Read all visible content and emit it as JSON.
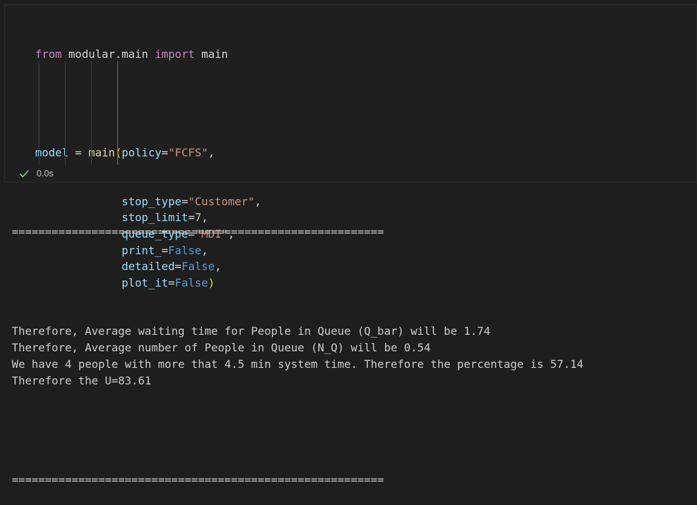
{
  "cell": {
    "import_line": {
      "from": "from",
      "module": "modular.main",
      "import": "import",
      "name": "main"
    },
    "call": {
      "var": "model",
      "eq": " = ",
      "fn": "main",
      "open": "(",
      "close": ")",
      "args": [
        {
          "name": "policy",
          "value": "\"FCFS\"",
          "type": "str",
          "suffix": ","
        },
        {
          "name": "stop_type",
          "value": "\"Customer\"",
          "type": "str",
          "suffix": ","
        },
        {
          "name": "stop_limit",
          "value": "7",
          "type": "num",
          "suffix": ","
        },
        {
          "name": "queue_type",
          "value": "\"MDI\"",
          "type": "str",
          "suffix": ","
        },
        {
          "name": "print_",
          "value": "False",
          "type": "bool",
          "suffix": ","
        },
        {
          "name": "detailed",
          "value": "False",
          "type": "bool",
          "suffix": ","
        },
        {
          "name": "plot_it",
          "value": "False",
          "type": "bool",
          "suffix": ""
        }
      ]
    },
    "exec_time": "0.0s",
    "exec_status_icon": "check-icon",
    "status_color": "#89d185"
  },
  "output": {
    "separator": "========================================================",
    "lines": [
      "Therefore, Average waiting time for People in Queue (Q_bar) will be 1.74",
      "Therefore, Average number of People in Queue (N_Q) will be 0.54",
      "We have 4 people with more that 4.5 min system time. Therefore the percentage is 57.14",
      "Therefore the U=83.61"
    ]
  }
}
